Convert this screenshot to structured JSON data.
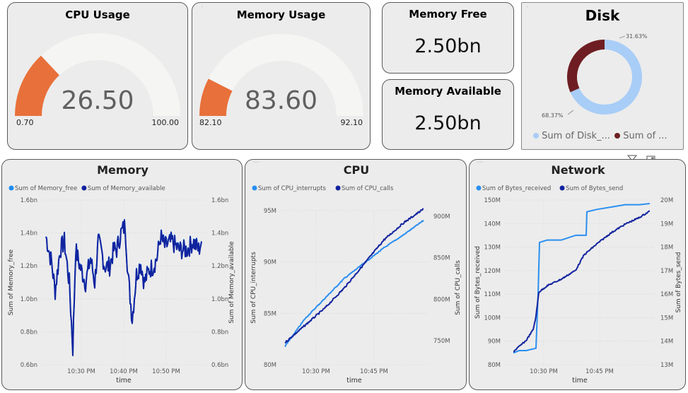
{
  "cpu_usage": {
    "title": "CPU Usage",
    "value": "26.50",
    "min": "0.70",
    "max": "100.00",
    "fraction": 0.26
  },
  "memory_usage": {
    "title": "Memory Usage",
    "value": "83.60",
    "min": "82.10",
    "max": "92.10",
    "fraction": 0.15
  },
  "memory_free": {
    "title": "Memory Free",
    "value": "2.50bn"
  },
  "memory_available": {
    "title": "Memory Available",
    "value": "2.50bn"
  },
  "disk": {
    "title": "Disk",
    "legend": [
      {
        "label": "Sum of Disk_...",
        "color": "#a8cdf7"
      },
      {
        "label": "Sum of ...",
        "color": "#6e1e22"
      }
    ],
    "chart_data": {
      "type": "pie",
      "values": [
        68.37,
        31.63
      ],
      "labels": [
        "68.37%",
        "31.63%"
      ],
      "colors": [
        "#a8cdf7",
        "#6e1e22"
      ]
    }
  },
  "memory_chart": {
    "title": "Memory",
    "legend": [
      "Sum of Memory_free",
      "Sum of Memory_available"
    ],
    "xlabel": "time",
    "ylabel_left": "Sum of Memory_free",
    "ylabel_right": "Sum of Memory_available",
    "yticks_left": [
      "1.6bn",
      "1.4bn",
      "1.2bn",
      "1.0bn",
      "0.8bn",
      "0.6bn"
    ],
    "yticks_right": [
      "1.6bn",
      "1.4bn",
      "1.2bn",
      "1.0bn",
      "0.8bn",
      "0.6bn"
    ],
    "xticks": [
      "10:30 PM",
      "10:40 PM",
      "10:50 PM"
    ],
    "colors": [
      "#1f8ef1",
      "#12239e"
    ]
  },
  "cpu_chart": {
    "title": "CPU",
    "legend": [
      "Sum of CPU_interrupts",
      "Sum of CPU_calls"
    ],
    "xlabel": "time",
    "ylabel_left": "Sum of CPU_interrupts",
    "ylabel_right": "Sum of CPU_calls",
    "yticks_left": [
      "95M",
      "90M",
      "85M",
      "80M"
    ],
    "yticks_right": [
      "900M",
      "850M",
      "800M",
      "750M"
    ],
    "xticks": [
      "10:30 PM",
      "10:45 PM"
    ],
    "colors": [
      "#2b8ff0",
      "#12239e"
    ]
  },
  "network_chart": {
    "title": "Network",
    "legend": [
      "Sum of Bytes_received",
      "Sum of Bytes_send"
    ],
    "xlabel": "time",
    "ylabel_left": "Sum of Bytes_received",
    "ylabel_right": "Sum of Bytes_send",
    "yticks_left": [
      "150M",
      "140M",
      "130M",
      "120M",
      "110M",
      "100M",
      "90M",
      "80M"
    ],
    "yticks_right": [
      "20M",
      "19M",
      "18M",
      "17M",
      "16M",
      "15M",
      "14M",
      "13M"
    ],
    "xticks": [
      "10:30 PM",
      "10:45 PM"
    ],
    "colors": [
      "#2b8ff0",
      "#12239e"
    ]
  },
  "chart_data": [
    {
      "type": "line",
      "title": "Memory",
      "xlabel": "time",
      "ylabel": "Sum of Memory_free",
      "x": [
        "10:30 PM",
        "10:40 PM",
        "10:50 PM"
      ],
      "series": [
        {
          "name": "Sum of Memory_free",
          "values": [
            1.4,
            1.25,
            1.3,
            1.35,
            1.0,
            1.3,
            1.45,
            1.3,
            0.95,
            1.05,
            1.35,
            1.3,
            1.3,
            1.35
          ]
        },
        {
          "name": "Sum of Memory_available",
          "values": [
            1.4,
            1.25,
            1.3,
            1.35,
            0.7,
            1.3,
            1.45,
            1.3,
            0.85,
            1.05,
            1.35,
            1.3,
            1.3,
            1.35
          ]
        }
      ],
      "ylim": [
        0.6,
        1.6
      ]
    },
    {
      "type": "line",
      "title": "CPU",
      "xlabel": "time",
      "x": [
        "10:30 PM",
        "10:45 PM"
      ],
      "series": [
        {
          "name": "Sum of CPU_interrupts",
          "values": [
            81.8,
            84.5,
            86.5,
            88.5,
            90.0,
            91.5,
            92.8,
            94.2
          ]
        },
        {
          "name": "Sum of CPU_calls",
          "values": [
            720,
            745,
            770,
            800,
            835,
            870,
            895,
            915
          ]
        }
      ],
      "ylim": [
        80,
        96
      ]
    },
    {
      "type": "line",
      "title": "Network",
      "xlabel": "time",
      "x": [
        "10:30 PM",
        "10:45 PM"
      ],
      "series": [
        {
          "name": "Sum of Bytes_received",
          "values": [
            85,
            87,
            87,
            132,
            133,
            135,
            135,
            145,
            147,
            148
          ]
        },
        {
          "name": "Sum of Bytes_send",
          "values": [
            13.2,
            13.7,
            14.0,
            15.9,
            16.2,
            16.7,
            17.3,
            18.2,
            18.9,
            19.6
          ]
        }
      ],
      "ylim": [
        80,
        150
      ]
    }
  ]
}
